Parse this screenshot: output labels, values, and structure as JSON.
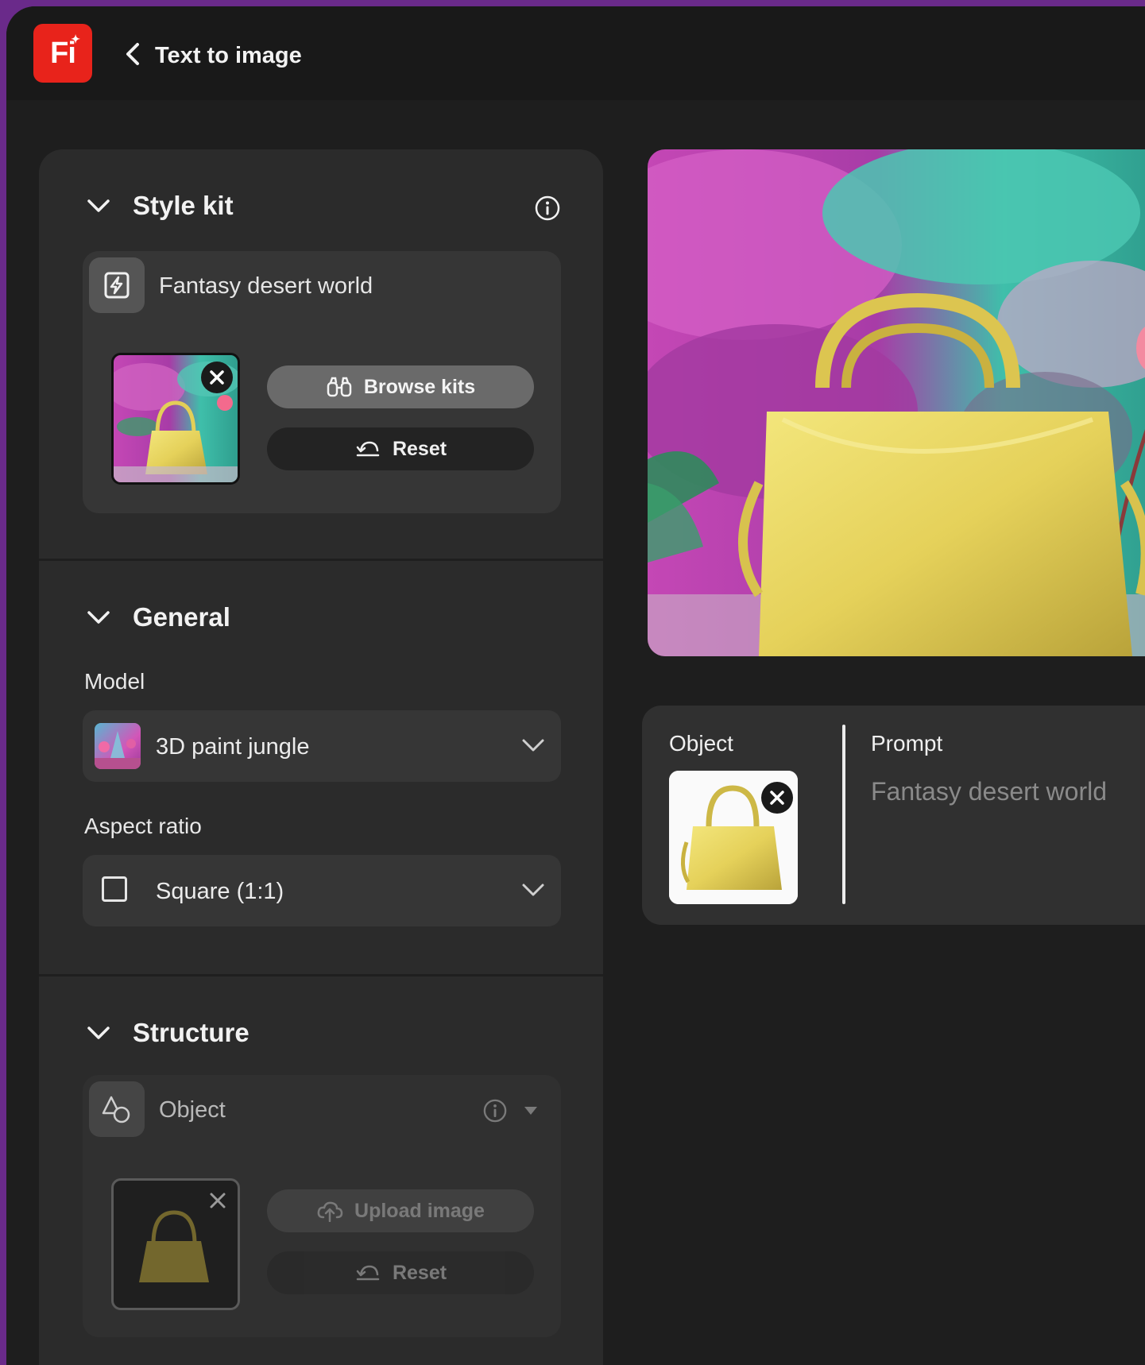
{
  "header": {
    "app_logo_text": "Fi",
    "page_title": "Text to image"
  },
  "style_kit": {
    "title": "Style kit",
    "kit_name": "Fantasy desert world",
    "browse_label": "Browse kits",
    "reset_label": "Reset"
  },
  "general": {
    "title": "General",
    "model_label": "Model",
    "model_value": "3D paint jungle",
    "aspect_label": "Aspect ratio",
    "aspect_value": "Square (1:1)"
  },
  "structure": {
    "title": "Structure",
    "type_label": "Object",
    "upload_label": "Upload image",
    "reset_label": "Reset"
  },
  "summary": {
    "object_label": "Object",
    "prompt_label": "Prompt",
    "prompt_value": "Fantasy desert world"
  },
  "colors": {
    "brand": "#e8231b",
    "panel": "#2b2b2b",
    "background": "#1e1e1e",
    "bag": "#e6d45a"
  }
}
